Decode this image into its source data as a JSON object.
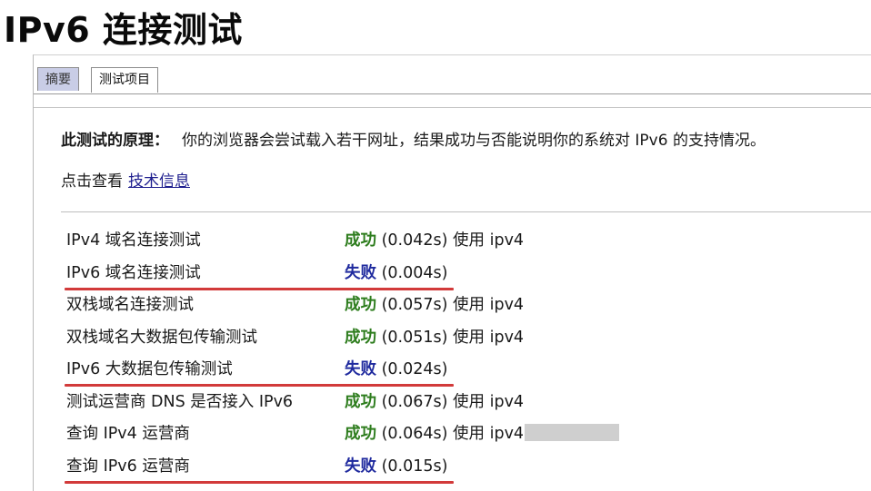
{
  "page": {
    "title": "IPv6 连接测试"
  },
  "tabs": [
    {
      "label": "摘要",
      "active": false
    },
    {
      "label": "测试项目",
      "active": true
    }
  ],
  "principle": {
    "label": "此测试的原理：",
    "text": "你的浏览器会尝试载入若干网址，结果成功与否能说明你的系统对 IPv6 的支持情况。"
  },
  "tech": {
    "prefix": "点击查看",
    "link_label": "技术信息"
  },
  "results": [
    {
      "name": "IPv4 域名连接测试",
      "status": "成功",
      "ok": true,
      "time": "(0.042s)",
      "via": "使用 ipv4",
      "highlight": false
    },
    {
      "name": "IPv6 域名连接测试",
      "status": "失败",
      "ok": false,
      "time": "(0.004s)",
      "via": "",
      "highlight": true
    },
    {
      "name": "双栈域名连接测试",
      "status": "成功",
      "ok": true,
      "time": "(0.057s)",
      "via": "使用 ipv4",
      "highlight": false
    },
    {
      "name": "双栈域名大数据包传输测试",
      "status": "成功",
      "ok": true,
      "time": "(0.051s)",
      "via": "使用 ipv4",
      "highlight": false
    },
    {
      "name": "IPv6 大数据包传输测试",
      "status": "失败",
      "ok": false,
      "time": "(0.024s)",
      "via": "",
      "highlight": true
    },
    {
      "name": "测试运营商 DNS 是否接入 IPv6",
      "status": "成功",
      "ok": true,
      "time": "(0.067s)",
      "via": "使用 ipv4",
      "highlight": false
    },
    {
      "name": "查询 IPv4 运营商",
      "status": "成功",
      "ok": true,
      "time": "(0.064s)",
      "via": "使用 ipv4",
      "highlight": false,
      "redacted": true
    },
    {
      "name": "查询 IPv6 运营商",
      "status": "失败",
      "ok": false,
      "time": "(0.015s)",
      "via": "",
      "highlight": true
    }
  ],
  "colors": {
    "success": "#2e7d1e",
    "failure": "#1f2a9e",
    "highlight_underline": "#d23a3a",
    "inactive_tab": "#c9cde6"
  }
}
